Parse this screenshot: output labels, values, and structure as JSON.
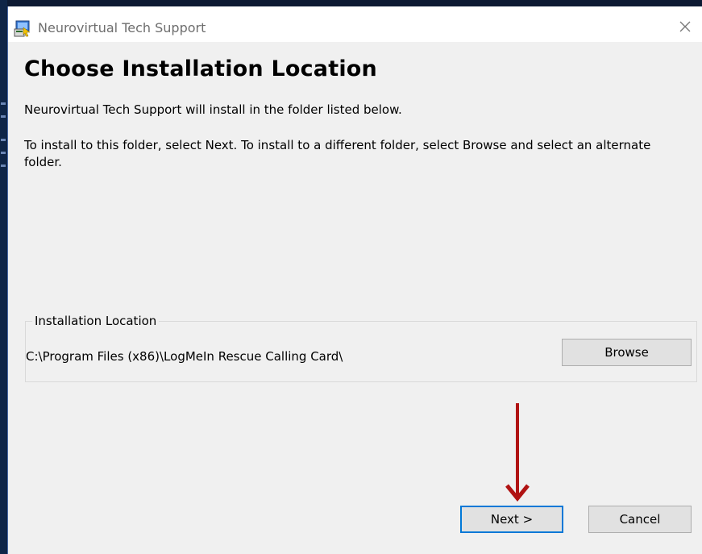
{
  "window": {
    "title": "Neurovirtual Tech Support",
    "app_icon": "installer-icon",
    "close_icon": "close-icon"
  },
  "page": {
    "heading": "Choose Installation Location",
    "description_line1": "Neurovirtual Tech Support will install in the folder listed below.",
    "description_line2": "To install to this folder, select Next.  To install to a different folder, select Browse and select an alternate folder."
  },
  "location_group": {
    "label": "Installation Location",
    "path": "C:\\Program Files (x86)\\LogMeIn Rescue Calling Card\\",
    "browse_label": "Browse"
  },
  "footer": {
    "next_label": "Next >",
    "cancel_label": "Cancel"
  },
  "annotation": {
    "arrow_icon": "down-arrow-icon",
    "arrow_color": "#b01313"
  },
  "colors": {
    "focus_border": "#0078d7",
    "dialog_bg": "#f0f0f0",
    "button_bg": "#e1e1e1"
  }
}
